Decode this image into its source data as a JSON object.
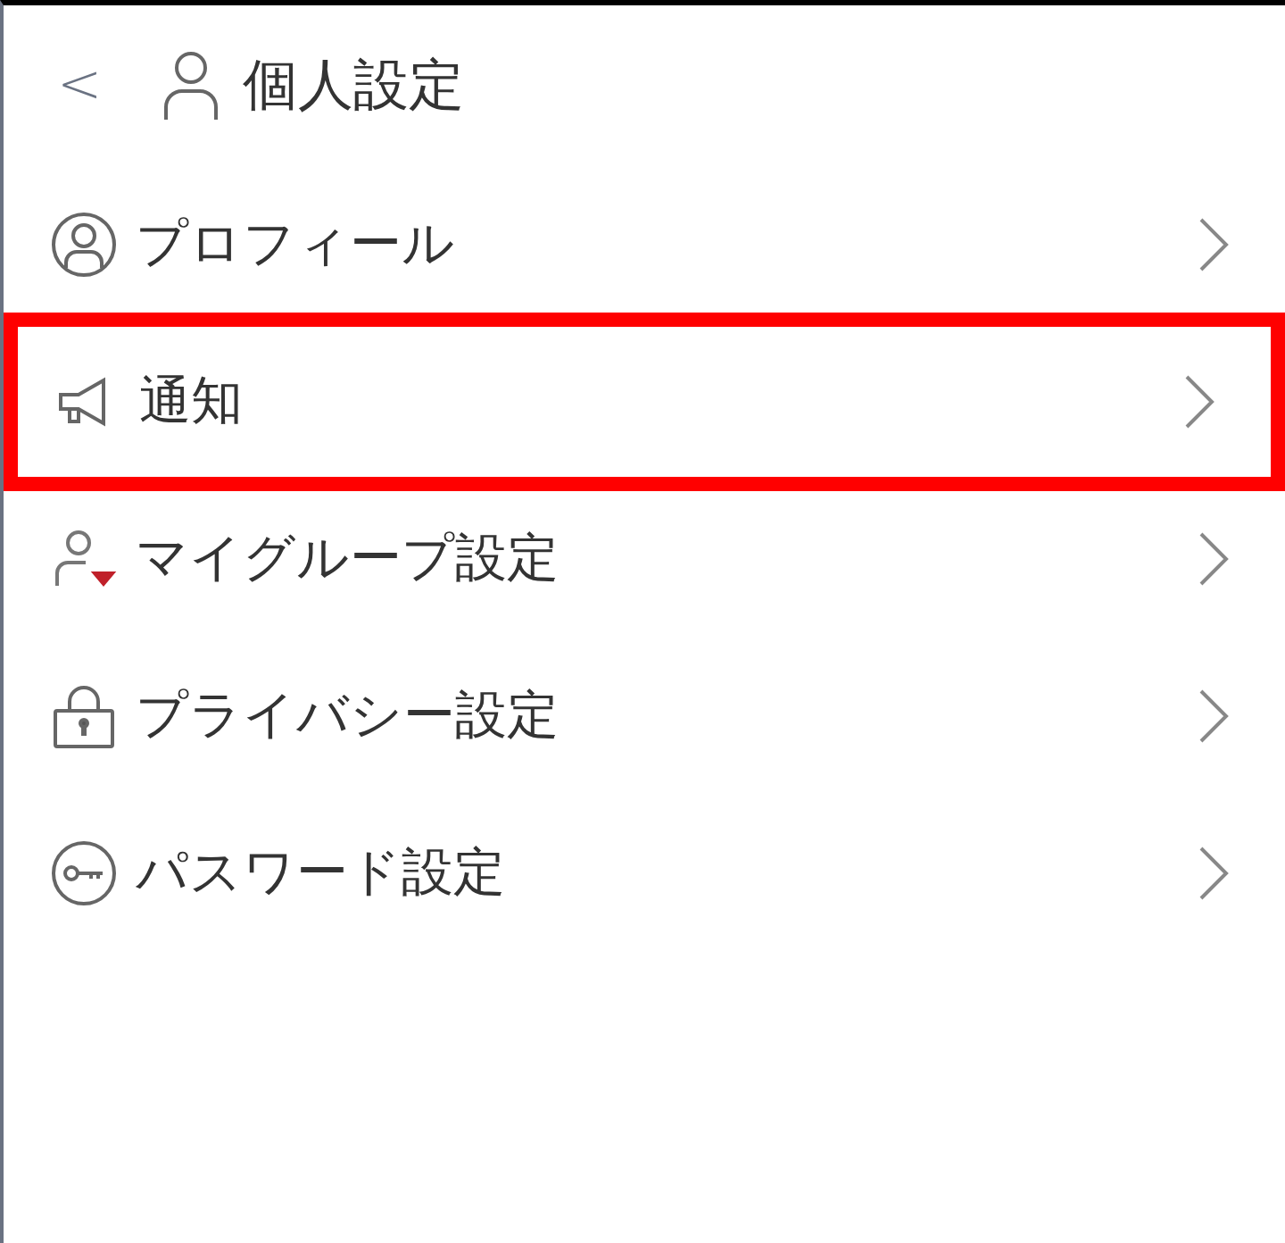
{
  "header": {
    "back": "<",
    "title": "個人設定"
  },
  "items": [
    {
      "kind": "profile",
      "label": "プロフィール",
      "highlighted": false
    },
    {
      "kind": "notice",
      "label": "通知",
      "highlighted": true
    },
    {
      "kind": "group",
      "label": "マイグループ設定",
      "highlighted": false
    },
    {
      "kind": "privacy",
      "label": "プライバシー設定",
      "highlighted": false
    },
    {
      "kind": "password",
      "label": "パスワード設定",
      "highlighted": false
    }
  ]
}
